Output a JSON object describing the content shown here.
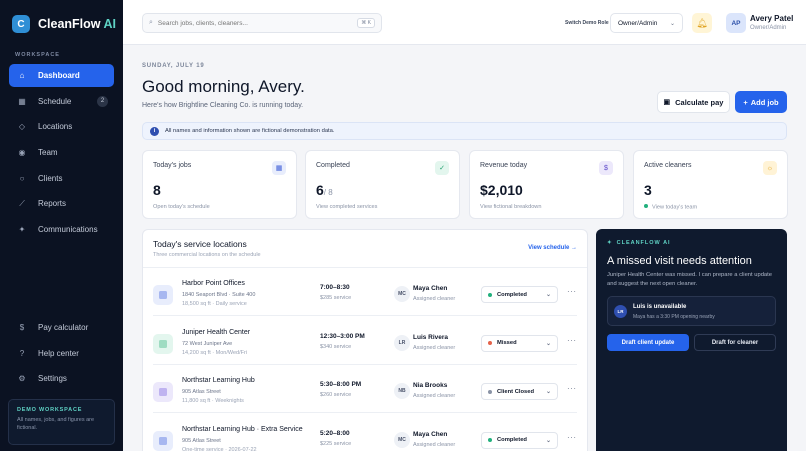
{
  "brand": {
    "logo_letter": "C",
    "name": "CleanFlow",
    "name_ai": "AI"
  },
  "sidebar": {
    "section_label": "WORKSPACE",
    "items": [
      {
        "label": "Dashboard",
        "icon": "home-icon",
        "glyph": "⌂"
      },
      {
        "label": "Schedule",
        "icon": "calendar-icon",
        "glyph": "▦",
        "badge": "2"
      },
      {
        "label": "Locations",
        "icon": "location-pin-icon",
        "glyph": "◇"
      },
      {
        "label": "Team",
        "icon": "team-icon",
        "glyph": "◉"
      },
      {
        "label": "Clients",
        "icon": "clients-icon",
        "glyph": "○"
      },
      {
        "label": "Reports",
        "icon": "reports-icon",
        "glyph": "⟋"
      },
      {
        "label": "Communications",
        "icon": "sparkle-icon",
        "glyph": "✦"
      }
    ],
    "bottom_items": [
      {
        "label": "Pay calculator",
        "icon": "dollar-icon",
        "glyph": "$"
      },
      {
        "label": "Help center",
        "icon": "help-icon",
        "glyph": "?"
      },
      {
        "label": "Settings",
        "icon": "gear-icon",
        "glyph": "⚙"
      }
    ],
    "demo": {
      "title": "DEMO WORKSPACE",
      "text": "All names, jobs, and figures are fictional."
    }
  },
  "header": {
    "search_placeholder": "Search jobs, clients, cleaners...",
    "shortcut": "⌘ K",
    "switch_label": "Switch Demo Role",
    "role": "Owner/Admin",
    "avatar_initials": "AP",
    "user_name": "Avery Patel",
    "user_role": "Owner/Admin"
  },
  "main": {
    "date": "SUNDAY, JULY 19",
    "greeting": "Good morning, Avery.",
    "subtitle": "Here's how Brightline Cleaning Co. is running today.",
    "calc_button": "Calculate pay",
    "add_button": "Add job",
    "notice": "All names and information shown are fictional demonstration data."
  },
  "stats": [
    {
      "label": "Today's jobs",
      "value": "8",
      "den": "",
      "link": "Open today's schedule",
      "icon": "calendar-icon",
      "glyph": "▦",
      "color": "#3b5bd6",
      "bg": "#e8edfc"
    },
    {
      "label": "Completed",
      "value": "6",
      "den": "/ 8",
      "link": "View completed services",
      "icon": "check-icon",
      "glyph": "✓",
      "color": "#1f9d6c",
      "bg": "#e3f6ee"
    },
    {
      "label": "Revenue today",
      "value": "$2,010",
      "den": "",
      "link": "View fictional breakdown",
      "icon": "dollar-icon",
      "glyph": "$",
      "color": "#5b46c9",
      "bg": "#ece8fb"
    },
    {
      "label": "Active cleaners",
      "value": "3",
      "den": "",
      "link": "View today's team",
      "icon": "sun-icon",
      "glyph": "☼",
      "color": "#e0a321",
      "bg": "#fff3d6"
    }
  ],
  "locations": {
    "title": "Today's service locations",
    "subtitle": "Three commercial locations on the schedule",
    "view_link": "View schedule",
    "rows": [
      {
        "name": "Harbor Point Offices",
        "address": "1840 Seaport Blvd · Suite 400",
        "meta": "18,500 sq ft · Daily service",
        "time": "7:00–8:30",
        "price": "$285 service",
        "initials": "MC",
        "cleaner": "Maya Chen",
        "role": "Assigned cleaner",
        "status": "Completed",
        "status_color": "#22b07d",
        "icon_bg": "#e8edfc",
        "icon_fg": "#a7b7f0"
      },
      {
        "name": "Juniper Health Center",
        "address": "72 West Juniper Ave",
        "meta": "14,200 sq ft · Mon/Wed/Fri",
        "time": "12:30–3:00 PM",
        "price": "$340 service",
        "initials": "LR",
        "cleaner": "Luis Rivera",
        "role": "Assigned cleaner",
        "status": "Missed",
        "status_color": "#e5624a",
        "icon_bg": "#e3f6ee",
        "icon_fg": "#9fdcc2"
      },
      {
        "name": "Northstar Learning Hub",
        "address": "905 Atlas Street",
        "meta": "11,800 sq ft · Weeknights",
        "time": "5:30–8:00 PM",
        "price": "$260 service",
        "initials": "NB",
        "cleaner": "Nia Brooks",
        "role": "Assigned cleaner",
        "status": "Client Closed",
        "status_color": "#8a93a6",
        "icon_bg": "#ece8fb",
        "icon_fg": "#bfb3f0"
      },
      {
        "name": "Northstar Learning Hub · Extra Service",
        "address": "905 Atlas Street",
        "meta": "One-time service · 2026-07-22",
        "time": "5:20–8:00",
        "price": "$225 service",
        "initials": "MC",
        "cleaner": "Maya Chen",
        "role": "Assigned cleaner",
        "status": "Completed",
        "status_color": "#22b07d",
        "icon_bg": "#e8edfc",
        "icon_fg": "#a7b7f0"
      }
    ]
  },
  "ai": {
    "tag": "CLEANFLOW AI",
    "title": "A missed visit needs attention",
    "text": "Juniper Health Center was missed. I can prepare a client update and suggest the next open cleaner.",
    "alert_initials": "LR",
    "alert_title": "Luis is unavailable",
    "alert_text": "Maya has a 3:30 PM opening nearby",
    "btn_primary": "Draft client update",
    "btn_secondary": "Draft for cleaner"
  }
}
